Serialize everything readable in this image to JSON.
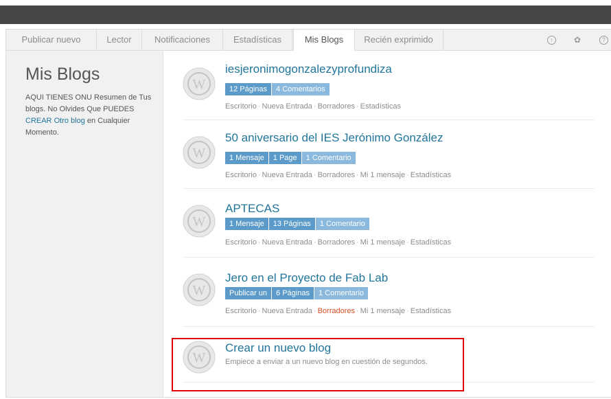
{
  "tabs": [
    "Publicar nuevo",
    "Lector",
    "Notificaciones",
    "Estadísticas",
    "Mis Blogs",
    "Recién exprimido"
  ],
  "active_tab": "Mis Blogs",
  "toolbar_icons": [
    "upload-icon",
    "gear-icon",
    "help-icon"
  ],
  "sidebar": {
    "title": "Mis Blogs",
    "desc_1": "AQUI TIENES ONU Resumen de Tus blogs. No Olvides Que PUEDES ",
    "desc_link_crear": "CREAR",
    "desc_link_otro_blog": "Otro blog",
    "desc_2": " en Cualquier Momento."
  },
  "blogs": [
    {
      "name": "iesjeronimogonzalezyprofundiza",
      "badges": [
        "12 Páginas",
        "4 Comentarios"
      ],
      "links": [
        "Escritorio",
        "Nueva Entrada",
        "Borradores",
        "Estadísticas"
      ]
    },
    {
      "name": "50 aniversario del IES Jerónimo González",
      "badges": [
        "1 Mensaje",
        "1 Page",
        "1 Comentario"
      ],
      "links": [
        "Escritorio",
        "Nueva Entrada",
        "Borradores",
        "Mi 1 mensaje",
        "Estadísticas"
      ]
    },
    {
      "name": "APTECAS",
      "badges": [
        "1 Mensaje",
        "13 Páginas",
        "1 Comentario"
      ],
      "links": [
        "Escritorio",
        "Nueva Entrada",
        "Borradores",
        "Mi 1 mensaje",
        "Estadísticas"
      ]
    },
    {
      "name": "Jero en el Proyecto de Fab Lab",
      "badges": [
        "Publicar un",
        "6 Páginas",
        "1 Comentario"
      ],
      "links": [
        "Escritorio",
        "Nueva Entrada",
        "Borradores",
        "Mi 1 mensaje",
        "Estadísticas"
      ]
    }
  ],
  "new_blog": {
    "title": "Crear un nuevo blog",
    "description": "Empiece a enviar a un nuevo blog en cuestión de segundos."
  },
  "colors": {
    "link": "#21759b",
    "badge": "#5c9bc9",
    "badge_light": "#8ab9dd",
    "highlight": "#e30000",
    "topbar": "#464646"
  }
}
